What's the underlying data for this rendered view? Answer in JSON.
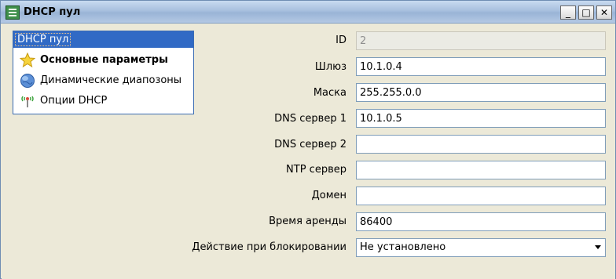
{
  "window": {
    "title": "DHCP пул",
    "buttons": {
      "minimize": "_",
      "maximize": "□",
      "close": "✕"
    }
  },
  "nav": {
    "header": "DHCP пул",
    "items": [
      {
        "label": "Основные параметры",
        "icon": "star-icon",
        "active": true
      },
      {
        "label": "Динамические диапозоны",
        "icon": "globe-icon",
        "active": false
      },
      {
        "label": "Опции DHCP",
        "icon": "antenna-icon",
        "active": false
      }
    ]
  },
  "form": {
    "id": {
      "label": "ID",
      "value": "2"
    },
    "gateway": {
      "label": "Шлюз",
      "value": "10.1.0.4"
    },
    "mask": {
      "label": "Маска",
      "value": "255.255.0.0"
    },
    "dns1": {
      "label": "DNS сервер 1",
      "value": "10.1.0.5"
    },
    "dns2": {
      "label": "DNS сервер 2",
      "value": ""
    },
    "ntp": {
      "label": "NTP сервер",
      "value": ""
    },
    "domain": {
      "label": "Домен",
      "value": ""
    },
    "lease": {
      "label": "Время аренды",
      "value": "86400"
    },
    "block_action": {
      "label": "Действие при блокировании",
      "value": "Не установлено"
    }
  },
  "colors": {
    "selection": "#316ac5",
    "window_bg": "#ece9d8",
    "field_border": "#7f9db9"
  }
}
